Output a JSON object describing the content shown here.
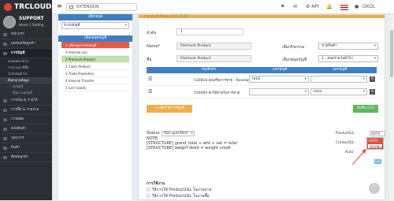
{
  "app": {
    "logo_text": "TRCLOUD"
  },
  "topbar": {
    "extension_label": "EXTENSION",
    "api_label": "API",
    "user_label": "OKOL"
  },
  "sidebar": {
    "company": "SUPPORT",
    "user_line": "Home  1 Setting",
    "items": [
      {
        "label": "หน้าแรก"
      },
      {
        "label": "แดชบอร์ดลูกค้า"
      },
      {
        "label": "การบัญชี",
        "active": true
      }
    ],
    "sub_items": [
      "สรุปยอดรายวัน",
      "รายงานภาษีซื้อ",
      "ใบสำคัญทั่วไป",
      "ตั้งค่าฐานข้อมูล"
    ],
    "sub2_items": [
      "ผังบัญชี",
      "ตั้งค่างวดบัญชี"
    ],
    "more_items": [
      {
        "label": "การเงิน & รายได้"
      },
      {
        "label": "การซื้อ & รายจ่าย"
      },
      {
        "label": "การผลิต"
      },
      {
        "label": "คลังสินค้า"
      },
      {
        "label": "บุคลากร"
      },
      {
        "label": "สินค้า"
      },
      {
        "label": "ติดต่อลูกค้า"
      }
    ]
  },
  "left_panel": {
    "header1": "เลือกสมุด",
    "select_value": "ระบบบัญชี",
    "header2": "เลือกสมุดบัญชี",
    "items": [
      {
        "label": "+ เพิ่มสมุดรายวันบัญชี",
        "style": "red"
      },
      {
        "label": "0 Internal use",
        "style": ""
      },
      {
        "label": "1 Premium Product",
        "style": "green"
      },
      {
        "label": "2 Claim Product",
        "style": ""
      },
      {
        "label": "3 Trade Promotion",
        "style": ""
      },
      {
        "label": "4 Internal Transfer",
        "style": ""
      },
      {
        "label": "5 Lost Goods",
        "style": ""
      }
    ]
  },
  "main": {
    "strip_text": "ลำดับบัญชี (ProductGL) 16:45:",
    "seq_label": "ลำดับ",
    "seq_value": "1",
    "name_label": "Name*",
    "name_value": "Premium Product",
    "name_th_label": "ชื่อ",
    "name_th_value": "Premium Product",
    "right_label1": "เลือกกิจกรรม",
    "right_value1": "ขายสินค้า",
    "right_label2": "เลือกสมุดบัญชี",
    "right_value2": "1 - สมุดรายวันทั่วไป",
    "table_headers": [
      "บัญชีหลัก",
      "แยกบัญชี",
      "แยกบัญชี"
    ],
    "rows": [
      {
        "code": "530810 ส่งเสริมการขาย - Review",
        "s1": "total",
        "s2": "-"
      },
      {
        "code": "530000 ค่าใช้จ่ายในการขาย",
        "s1": "-",
        "s2": "total"
      }
    ],
    "add_button": "+ เพิ่มรายการบัญชี",
    "save_button": "บันทึก (F2)",
    "status_label": "Status:",
    "status_value": "Not specified",
    "note_label": "NOTE:",
    "structure1": "[STRUCTURE] grand_total + wht + vat = total",
    "structure2": "[STRUCTURE] weight debit = weight credit",
    "productgl_label": "ProductGL:",
    "productgl_value": "AUTO",
    "contactgl_label": "ContactGL:",
    "auto_label": "Auto",
    "dropdown_options": [
      "AUTO",
      "DISABLE"
    ],
    "small_btn": "Edit",
    "notes_header": "การใช้งาน",
    "notes_line1": "ⓘ วิธีการใช้ Product2GL ในงานขาย",
    "notes_line2": "ⓘ วิธีการใช้ Product2GL ในงานซื้อ"
  }
}
